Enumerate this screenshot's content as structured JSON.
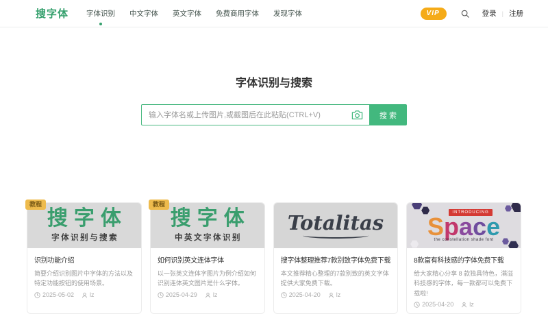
{
  "brand": {
    "logo": "搜字体"
  },
  "nav": {
    "items": [
      {
        "label": "字体识别"
      },
      {
        "label": "中文字体"
      },
      {
        "label": "英文字体"
      },
      {
        "label": "免费商用字体"
      },
      {
        "label": "发现字体"
      }
    ],
    "vip_label": "VIP",
    "login_label": "登录",
    "divider": "|",
    "register_label": "注册"
  },
  "hero": {
    "title": "字体识别与搜索",
    "search_placeholder": "输入字体名或上传图片,或截图后在此粘贴(CTRL+V)",
    "search_button_label": "搜 索"
  },
  "cards": [
    {
      "badge": "教程",
      "thumb": {
        "brand": "搜字体",
        "caption": "字体识别与搜索"
      },
      "title": "识别功能介绍",
      "desc": "简要介绍识别图片中字体的方法以及特定功能按钮的使用场景。",
      "date": "2025-05-02",
      "author": "lz"
    },
    {
      "badge": "教程",
      "thumb": {
        "brand": "搜字体",
        "caption": "中英文字体识别"
      },
      "title": "如何识别英文连体字体",
      "desc": "以一张英文连体字图片为例介绍如何识别连体英文图片是什么字体。",
      "date": "2025-04-29",
      "author": "lz"
    },
    {
      "thumb": {
        "script_text": "Totalitas"
      },
      "title": "搜字体整理推荐7款别致字体免费下载",
      "desc": "本文推荐精心整理的7款别致的英文字体提供大家免费下载。",
      "date": "2025-04-20",
      "author": "lz"
    },
    {
      "thumb": {
        "intro_label": "INTRODUCING",
        "word_letters": [
          {
            "ch": "S",
            "color": "#e8913b"
          },
          {
            "ch": "p",
            "color": "#c2386c"
          },
          {
            "ch": "a",
            "color": "#8a4a9e"
          },
          {
            "ch": "c",
            "color": "#6f4d9e"
          },
          {
            "ch": "e",
            "color": "#2e9aae"
          }
        ],
        "tagline": "the constellation shade font"
      },
      "title": "8款富有科技感的字体免费下载",
      "desc": "给大家精心分享 8 款独具特色，满溢科技感的字体，每一款都可以免费下载啦!",
      "date": "2025-04-20",
      "author": "lz"
    }
  ],
  "colors": {
    "brand_green": "#35a06d",
    "button_green": "#42b87e",
    "vip_orange": "#f5ab18",
    "badge_gold": "#eebb4d"
  }
}
